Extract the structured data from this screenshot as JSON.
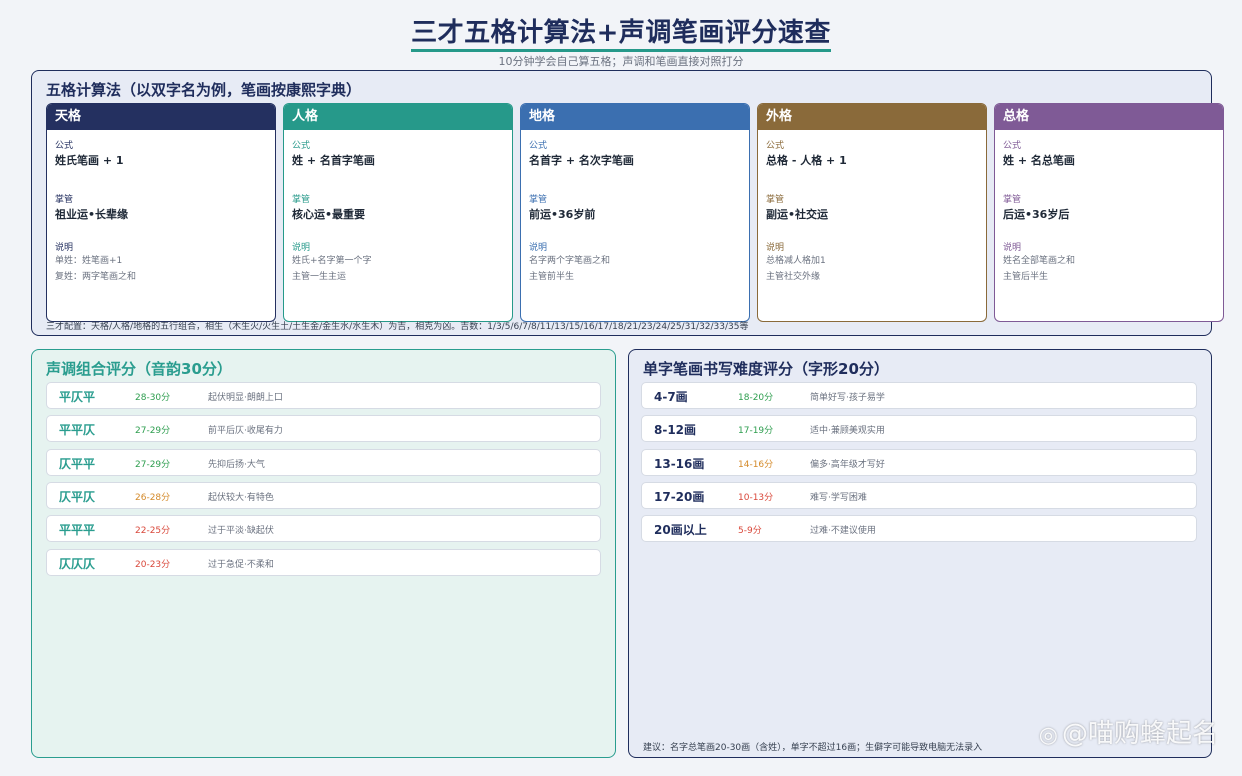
{
  "title": "三才五格计算法+声调笔画评分速查",
  "subtitle": "10分钟学会自己算五格；声调和笔画直接对照打分",
  "wuge": {
    "heading": "五格计算法（以双字名为例，笔画按康熙字典）",
    "label_formula": "公式",
    "label_governs": "掌管",
    "label_desc": "说明",
    "cards": [
      {
        "name": "天格",
        "color": "#243060",
        "formula": "姓氏笔画 + 1",
        "governs": "祖业运•长辈缘",
        "desc1": "单姓：姓笔画+1",
        "desc2": "复姓：两字笔画之和"
      },
      {
        "name": "人格",
        "color": "#26998a",
        "formula": "姓 + 名首字笔画",
        "governs": "核心运•最重要",
        "desc1": "姓氏+名字第一个字",
        "desc2": "主管一生主运"
      },
      {
        "name": "地格",
        "color": "#3b6fb0",
        "formula": "名首字 + 名次字笔画",
        "governs": "前运•36岁前",
        "desc1": "名字两个字笔画之和",
        "desc2": "主管前半生"
      },
      {
        "name": "外格",
        "color": "#8a6a3a",
        "formula": "总格 - 人格 + 1",
        "governs": "副运•社交运",
        "desc1": "总格减人格加1",
        "desc2": "主管社交外缘"
      },
      {
        "name": "总格",
        "color": "#7f5a96",
        "formula": "姓 + 名总笔画",
        "governs": "后运•36岁后",
        "desc1": "姓名全部笔画之和",
        "desc2": "主管后半生"
      }
    ],
    "note": "三才配置：天格/人格/地格的五行组合，相生（木生火/火生土/土生金/金生水/水生木）为吉，相克为凶。吉数：1/3/5/6/7/8/11/13/15/16/17/18/21/23/24/25/31/32/33/35等"
  },
  "tone": {
    "heading": "声调组合评分（音韵30分）",
    "rows": [
      {
        "k": "平仄平",
        "s": "28-30分",
        "color": "#2e9e4f",
        "d": "起伏明显·朗朗上口"
      },
      {
        "k": "平平仄",
        "s": "27-29分",
        "color": "#2e9e4f",
        "d": "前平后仄·收尾有力"
      },
      {
        "k": "仄平平",
        "s": "27-29分",
        "color": "#2e9e4f",
        "d": "先抑后扬·大气"
      },
      {
        "k": "仄平仄",
        "s": "26-28分",
        "color": "#d48a2a",
        "d": "起伏较大·有特色"
      },
      {
        "k": "平平平",
        "s": "22-25分",
        "color": "#d9483b",
        "d": "过于平淡·缺起伏"
      },
      {
        "k": "仄仄仄",
        "s": "20-23分",
        "color": "#d9483b",
        "d": "过于急促·不柔和"
      }
    ]
  },
  "stroke": {
    "heading": "单字笔画书写难度评分（字形20分）",
    "rows": [
      {
        "k": "4-7画",
        "s": "18-20分",
        "color": "#2e9e4f",
        "d": "简单好写·孩子易学"
      },
      {
        "k": "8-12画",
        "s": "17-19分",
        "color": "#2e9e4f",
        "d": "适中·兼顾美观实用"
      },
      {
        "k": "13-16画",
        "s": "14-16分",
        "color": "#d48a2a",
        "d": "偏多·高年级才写好"
      },
      {
        "k": "17-20画",
        "s": "10-13分",
        "color": "#d9483b",
        "d": "难写·学写困难"
      },
      {
        "k": "20画以上",
        "s": "5-9分",
        "color": "#d9483b",
        "d": "过难·不建议使用"
      }
    ],
    "note": "建议：名字总笔画20-30画（含姓），单字不超过16画；生僻字可能导致电脑无法录入"
  },
  "watermark": {
    "icon": "weibo-icon",
    "text": "@喵购蜂起名"
  }
}
